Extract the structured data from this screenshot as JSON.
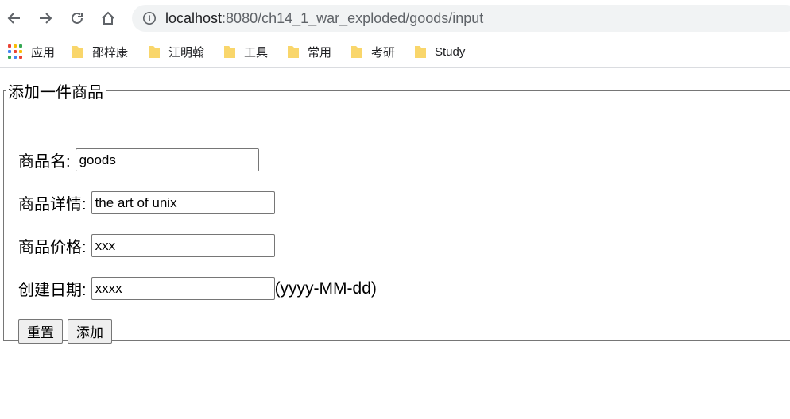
{
  "browser": {
    "url_host": "localhost",
    "url_path": ":8080/ch14_1_war_exploded/goods/input",
    "bookmarks": [
      {
        "label": "应用",
        "icon": "apps-grid-icon"
      },
      {
        "label": "邵梓康",
        "icon": "folder-icon"
      },
      {
        "label": "江明翰",
        "icon": "folder-icon"
      },
      {
        "label": "工具",
        "icon": "folder-icon"
      },
      {
        "label": "常用",
        "icon": "folder-icon"
      },
      {
        "label": "考研",
        "icon": "folder-icon"
      },
      {
        "label": "Study",
        "icon": "folder-icon"
      }
    ],
    "colors": {
      "folder": "#f9d66b",
      "omnibox_bg": "#f1f3f4",
      "apps": [
        "#ea4335",
        "#fbbc05",
        "#34a853",
        "#4285f4",
        "#ea4335",
        "#fbbc05",
        "#34a853",
        "#4285f4",
        "#ea4335"
      ]
    }
  },
  "form": {
    "legend": "添加一件商品",
    "fields": {
      "name": {
        "label": "商品名:",
        "value": "goods"
      },
      "detail": {
        "label": "商品详情:",
        "value": "the art of unix"
      },
      "price": {
        "label": "商品价格:",
        "value": "xxx"
      },
      "date": {
        "label": "创建日期:",
        "value": "xxxx",
        "hint": "(yyyy-MM-dd)"
      }
    },
    "buttons": {
      "reset": "重置",
      "submit": "添加"
    }
  }
}
